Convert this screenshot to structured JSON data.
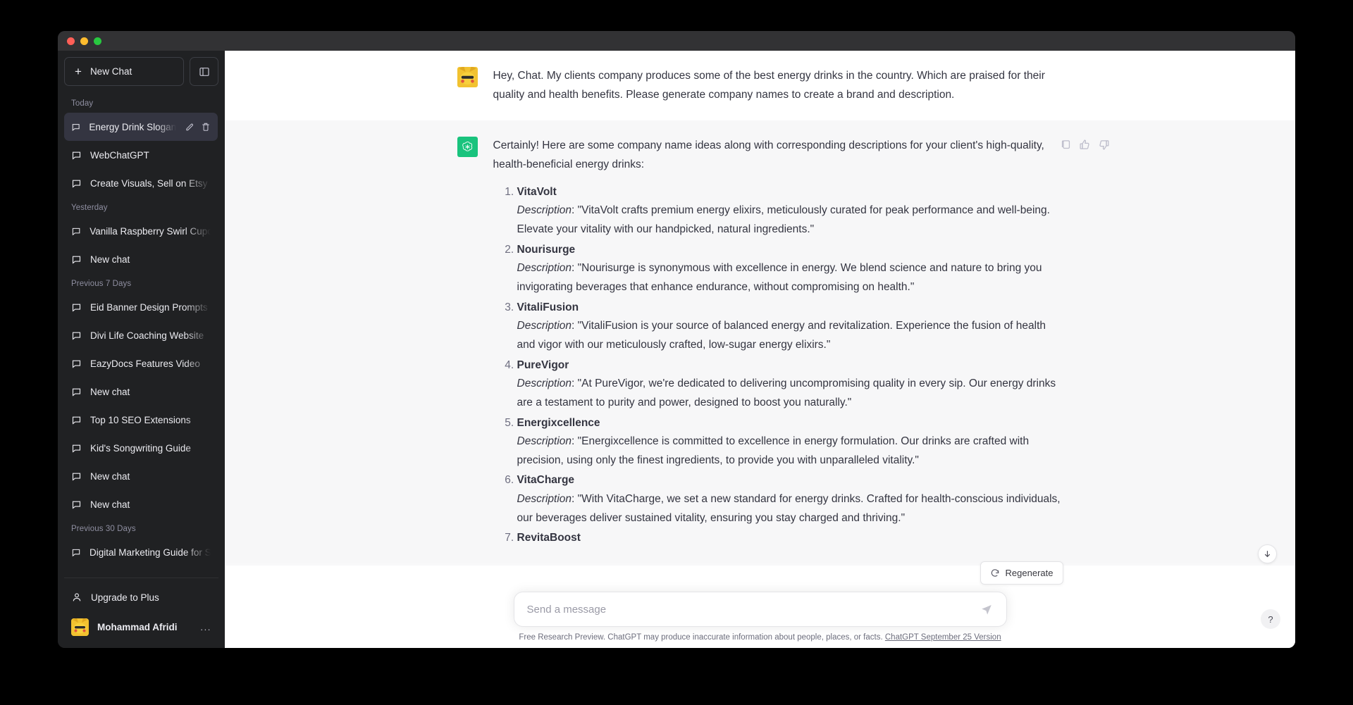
{
  "window": {
    "traffic_lights": [
      "close",
      "minimize",
      "maximize"
    ]
  },
  "sidebar": {
    "new_chat_label": "New Chat",
    "collapse_icon": "sidebar-panel-icon",
    "groups": [
      {
        "label": "Today",
        "items": [
          {
            "title": "Energy Drink Slogan Id",
            "active": true,
            "actions": [
              "edit-icon",
              "trash-icon"
            ]
          },
          {
            "title": "WebChatGPT",
            "active": false
          },
          {
            "title": "Create Visuals, Sell on Etsy",
            "active": false
          }
        ]
      },
      {
        "label": "Yesterday",
        "items": [
          {
            "title": "Vanilla Raspberry Swirl Cupca",
            "active": false
          },
          {
            "title": "New chat",
            "active": false
          }
        ]
      },
      {
        "label": "Previous 7 Days",
        "items": [
          {
            "title": "Eid Banner Design Prompts",
            "active": false
          },
          {
            "title": "Divi Life Coaching Website",
            "active": false
          },
          {
            "title": "EazyDocs Features Video",
            "active": false
          },
          {
            "title": "New chat",
            "active": false
          },
          {
            "title": "Top 10 SEO Extensions",
            "active": false
          },
          {
            "title": "Kid's Songwriting Guide",
            "active": false
          },
          {
            "title": "New chat",
            "active": false
          },
          {
            "title": "New chat",
            "active": false
          }
        ]
      },
      {
        "label": "Previous 30 Days",
        "items": [
          {
            "title": "Digital Marketing Guide for Stu",
            "active": false
          }
        ]
      }
    ],
    "upgrade_label": "Upgrade to Plus",
    "account_name": "Mohammad Afridi",
    "account_menu_label": "..."
  },
  "conversation": {
    "user_message": "Hey, Chat. My clients company produces some of the best energy drinks in the country. Which are praised for their quality and health benefits. Please generate company names to create a brand and description.",
    "assistant_intro": "Certainly! Here are some company name ideas along with corresponding descriptions for your client's high-quality, health-beneficial energy drinks:",
    "assistant_actions": [
      "copy-icon",
      "thumbs-up-icon",
      "thumbs-down-icon"
    ],
    "items": [
      {
        "name": "VitaVolt",
        "desc_label": "Description",
        "desc": ": \"VitaVolt crafts premium energy elixirs, meticulously curated for peak performance and well-being. Elevate your vitality with our handpicked, natural ingredients.\""
      },
      {
        "name": "Nourisurge",
        "desc_label": "Description",
        "desc": ": \"Nourisurge is synonymous with excellence in energy. We blend science and nature to bring you invigorating beverages that enhance endurance, without compromising on health.\""
      },
      {
        "name": "VitaliFusion",
        "desc_label": "Description",
        "desc": ": \"VitaliFusion is your source of balanced energy and revitalization. Experience the fusion of health and vigor with our meticulously crafted, low-sugar energy elixirs.\""
      },
      {
        "name": "PureVigor",
        "desc_label": "Description",
        "desc": ": \"At PureVigor, we're dedicated to delivering uncompromising quality in every sip. Our energy drinks are a testament to purity and power, designed to boost you naturally.\""
      },
      {
        "name": "Energixcellence",
        "desc_label": "Description",
        "desc": ": \"Energixcellence is committed to excellence in energy formulation. Our drinks are crafted with precision, using only the finest ingredients, to provide you with unparalleled vitality.\""
      },
      {
        "name": "VitaCharge",
        "desc_label": "Description",
        "desc": ": \"With VitaCharge, we set a new standard for energy drinks. Crafted for health-conscious individuals, our beverages deliver sustained vitality, ensuring you stay charged and thriving.\""
      },
      {
        "name": "RevitaBoost",
        "desc_label": "",
        "desc": ""
      }
    ]
  },
  "composer": {
    "regenerate_label": "Regenerate",
    "placeholder": "Send a message",
    "value": "",
    "send_icon": "send-icon",
    "scroll_down_icon": "arrow-down-icon",
    "help_label": "?"
  },
  "footer": {
    "note": "Free Research Preview. ChatGPT may produce inaccurate information about people, places, or facts.",
    "link": "ChatGPT September 25 Version"
  },
  "colors": {
    "sidebar_bg": "#202123",
    "active_item": "#343541",
    "assistant_bg": "#f7f7f8",
    "brand_green": "#19c37d"
  }
}
